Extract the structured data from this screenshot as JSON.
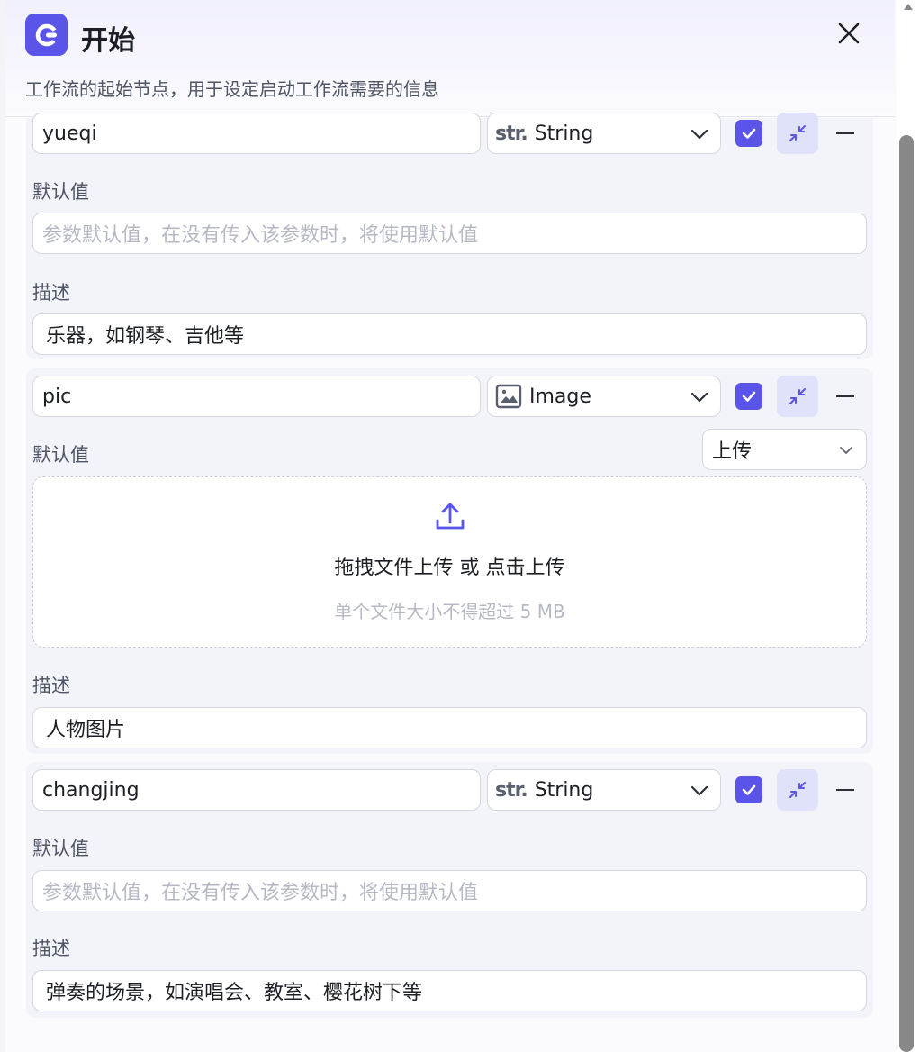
{
  "header": {
    "title": "开始",
    "subtitle": "工作流的起始节点，用于设定启动工作流需要的信息",
    "colors": {
      "accent": "#5a55e8"
    }
  },
  "labels": {
    "default_value": "默认值",
    "description": "描述"
  },
  "params": [
    {
      "name": "yueqi",
      "type_badge": "str.",
      "type_label": "String",
      "default_placeholder": "参数默认值，在没有传入该参数时，将使用默认值",
      "description": "乐器，如钢琴、吉他等"
    },
    {
      "name": "pic",
      "type_icon": "image-icon",
      "type_label": "Image",
      "upload_mode": "上传",
      "upload_main_text": "拖拽文件上传 或 点击上传",
      "upload_hint": "单个文件大小不得超过 5 MB",
      "description": "人物图片"
    },
    {
      "name": "changjing",
      "type_badge": "str.",
      "type_label": "String",
      "default_placeholder": "参数默认值，在没有传入该参数时，将使用默认值",
      "description": "弹奏的场景，如演唱会、教室、樱花树下等"
    }
  ]
}
